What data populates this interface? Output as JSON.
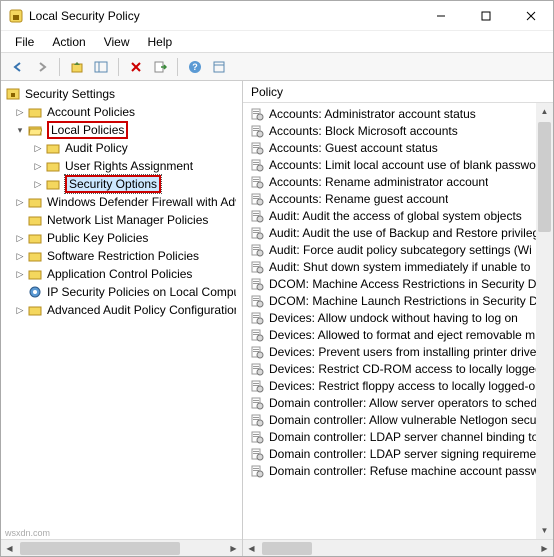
{
  "window": {
    "title": "Local Security Policy",
    "min_tip": "Minimize",
    "max_tip": "Maximize",
    "close_tip": "Close"
  },
  "menu": {
    "file": "File",
    "action": "Action",
    "view": "View",
    "help": "Help"
  },
  "tree": {
    "root": "Security Settings",
    "n0": "Account Policies",
    "n1": "Local Policies",
    "n1_0": "Audit Policy",
    "n1_1": "User Rights Assignment",
    "n1_2": "Security Options",
    "n2": "Windows Defender Firewall with Adva",
    "n3": "Network List Manager Policies",
    "n4": "Public Key Policies",
    "n5": "Software Restriction Policies",
    "n6": "Application Control Policies",
    "n7": "IP Security Policies on Local Compute",
    "n8": "Advanced Audit Policy Configuration"
  },
  "list": {
    "header": "Policy",
    "items": [
      "Accounts: Administrator account status",
      "Accounts: Block Microsoft accounts",
      "Accounts: Guest account status",
      "Accounts: Limit local account use of blank passwo",
      "Accounts: Rename administrator account",
      "Accounts: Rename guest account",
      "Audit: Audit the access of global system objects",
      "Audit: Audit the use of Backup and Restore privileg",
      "Audit: Force audit policy subcategory settings (Wi",
      "Audit: Shut down system immediately if unable to",
      "DCOM: Machine Access Restrictions in Security De",
      "DCOM: Machine Launch Restrictions in Security De",
      "Devices: Allow undock without having to log on",
      "Devices: Allowed to format and eject removable m",
      "Devices: Prevent users from installing printer driver",
      "Devices: Restrict CD-ROM access to locally logged-",
      "Devices: Restrict floppy access to locally logged-or",
      "Domain controller: Allow server operators to sched",
      "Domain controller: Allow vulnerable Netlogon secu",
      "Domain controller: LDAP server channel binding to",
      "Domain controller: LDAP server signing requiremen",
      "Domain controller: Refuse machine account passw"
    ]
  },
  "watermark": "wsxdn.com"
}
